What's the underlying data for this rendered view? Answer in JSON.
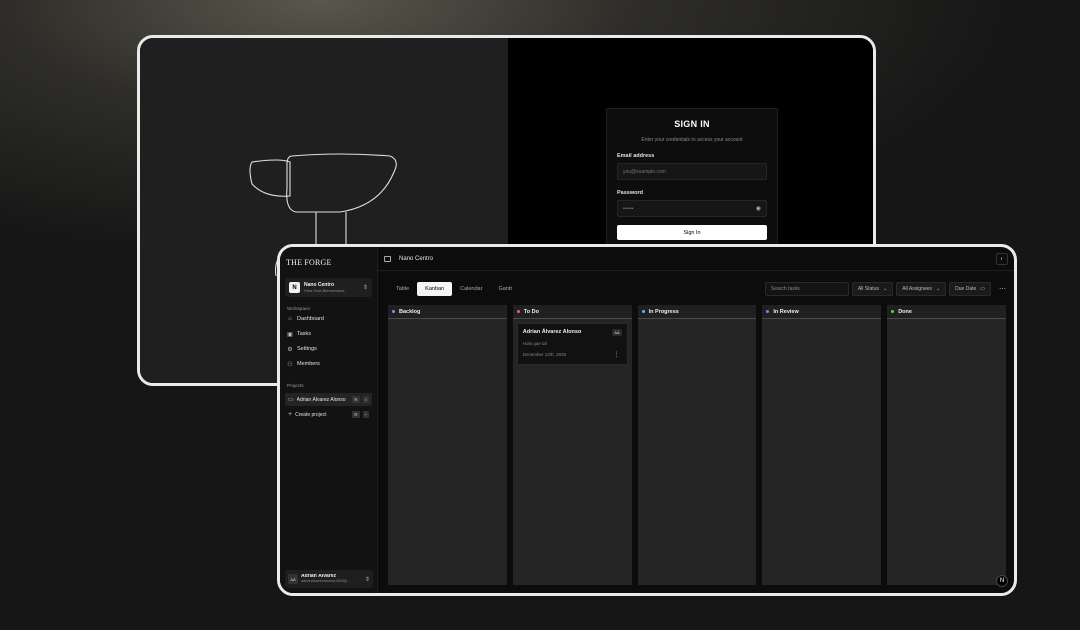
{
  "signin": {
    "title": "SIGN IN",
    "subtitle": "Enter your credentials to access your account",
    "email_label": "Email address",
    "email_placeholder": "you@example.com",
    "password_label": "Password",
    "password_value": "••••••",
    "submit_label": "Sign In"
  },
  "app": {
    "brand": "THE FORGE",
    "org": {
      "logo": "N",
      "name": "Nano Centro",
      "subtitle": "Hola Hola Bienvenidos"
    },
    "workspace_label": "Workspace",
    "nav": [
      {
        "label": "Dashboard",
        "icon": "⌂"
      },
      {
        "label": "Tasks",
        "icon": "▣"
      },
      {
        "label": "Settings",
        "icon": "⚙"
      },
      {
        "label": "Members",
        "icon": "⚇"
      }
    ],
    "projects_label": "Projects",
    "project": {
      "label": "Adrian Álvarez Alonso",
      "kbd1": "⌘",
      "kbd2": "0"
    },
    "create_project": {
      "label": "Create project",
      "kbd1": "⌘",
      "kbd2": "+"
    },
    "user": {
      "initials": "AÁ",
      "name": "Adrian Álvarez",
      "email": "adrianalvarezalonso1503@..."
    },
    "topbar": {
      "title": "Nano Centro"
    },
    "tabs": [
      "Table",
      "Kanban",
      "Calendar",
      "Gantt"
    ],
    "active_tab": "Kanban",
    "filters": {
      "search_placeholder": "Search tasks",
      "status": "All Status",
      "assignees": "All Assignees",
      "due_date": "Due Date"
    },
    "columns": [
      {
        "name": "Backlog",
        "color": "#8a8aff"
      },
      {
        "name": "To Do",
        "color": "#ff5c5c"
      },
      {
        "name": "In Progress",
        "color": "#5ab8ff"
      },
      {
        "name": "In Review",
        "color": "#a070ff"
      },
      {
        "name": "Done",
        "color": "#4cd964"
      }
    ],
    "card": {
      "title": "Adrian Álvarez Alonso",
      "badge": "AÁ",
      "description": "Hola que tal",
      "date": "December 12th, 2025"
    },
    "corner_badge": "N"
  },
  "colors": {
    "background": "#1a1a1a",
    "frame_border": "#eaeaea",
    "panel": "#252525"
  }
}
